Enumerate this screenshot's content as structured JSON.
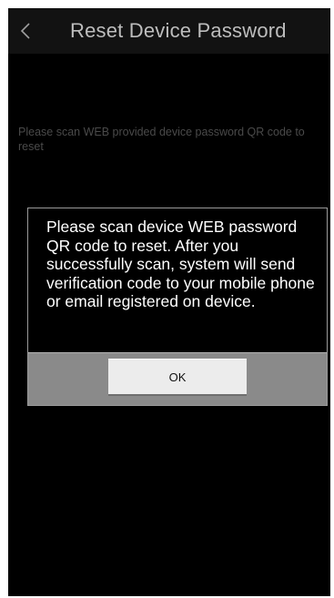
{
  "header": {
    "title": "Reset Device Password",
    "back_icon": "chevron-left-icon"
  },
  "main": {
    "hint_text": "Please scan WEB provided device password QR code to reset"
  },
  "dialog": {
    "message": "Please scan device WEB password QR code to reset. After you successfully scan, system will send verification code to your mobile phone or email registered on device.",
    "ok_label": "OK"
  },
  "colors": {
    "background": "#000000",
    "titlebar": "#121212",
    "dialog_footer": "#8a8a8a",
    "ok_button": "#ececec"
  }
}
